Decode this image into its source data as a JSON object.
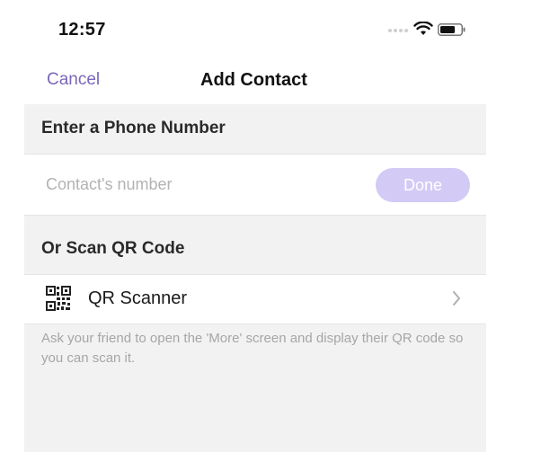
{
  "status_bar": {
    "time": "12:57",
    "icons": [
      "signal-dots-icon",
      "wifi-icon",
      "battery-icon"
    ]
  },
  "nav": {
    "cancel_label": "Cancel",
    "title": "Add Contact"
  },
  "phone_section": {
    "header": "Enter a Phone Number",
    "input_value": "",
    "input_placeholder": "Contact's number",
    "done_label": "Done"
  },
  "qr_section": {
    "header": "Or Scan QR Code",
    "scanner_label": "QR Scanner",
    "note": "Ask your friend to open the 'More' screen and display their QR code so you can scan it."
  },
  "colors": {
    "accent": "#7b67b8",
    "done_disabled": "#d3cbf5",
    "background": "#f2f2f2"
  }
}
